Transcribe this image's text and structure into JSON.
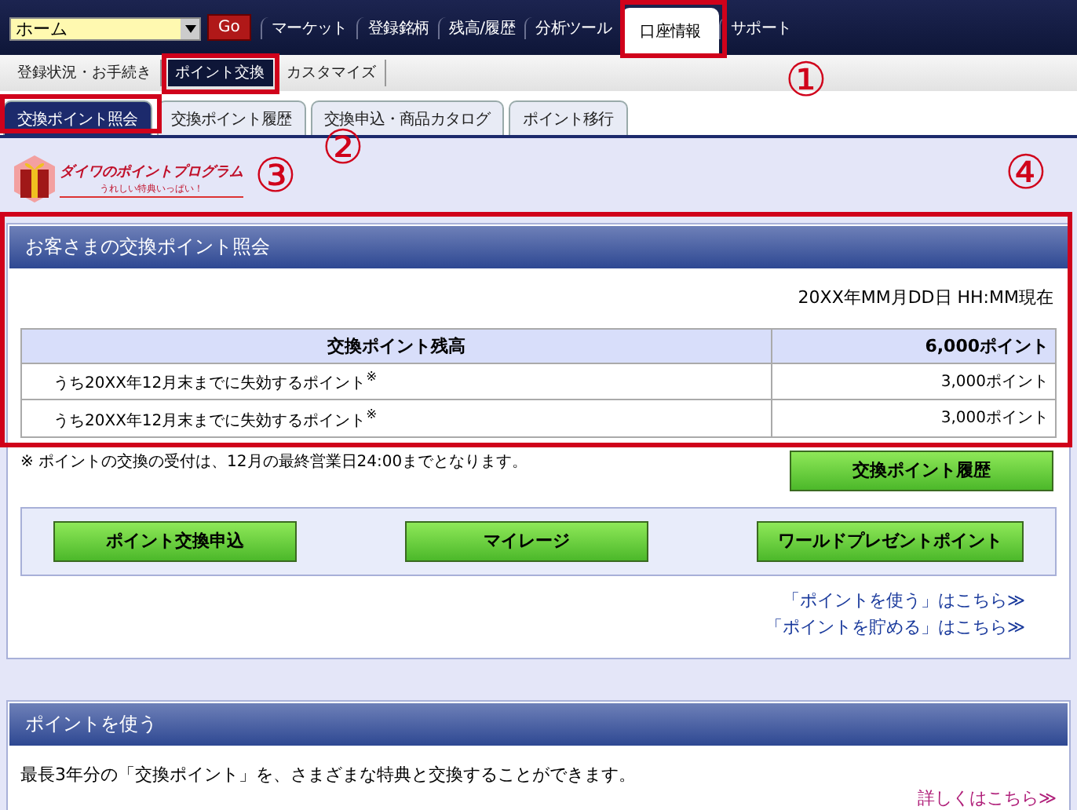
{
  "top_nav": {
    "select": "ホーム",
    "go": "Go",
    "items": [
      {
        "label": "マーケット",
        "selected": false
      },
      {
        "label": "登録銘柄",
        "selected": false
      },
      {
        "label": "残高/履歴",
        "selected": false
      },
      {
        "label": "分析ツール",
        "selected": false
      },
      {
        "label": "口座情報",
        "selected": true
      },
      {
        "label": "サポート",
        "selected": false
      }
    ]
  },
  "sub_nav": [
    {
      "label": "登録状況・お手続き",
      "selected": false
    },
    {
      "label": "ポイント交換",
      "selected": true
    },
    {
      "label": "カスタマイズ",
      "selected": false
    }
  ],
  "tabs": [
    {
      "label": "交換ポイント照会",
      "selected": true
    },
    {
      "label": "交換ポイント履歴",
      "selected": false
    },
    {
      "label": "交換申込・商品カタログ",
      "selected": false
    },
    {
      "label": "ポイント移行",
      "selected": false
    }
  ],
  "logo": {
    "title": "ダイワのポイントプログラム",
    "tagline": "うれしい特典いっぱい！"
  },
  "balance_panel": {
    "title": "お客さまの交換ポイント照会",
    "timestamp": "20XX年MM月DD日 HH:MM現在",
    "table": {
      "header": [
        "交換ポイント残高",
        "6,000ポイント"
      ],
      "rows": [
        [
          "うち20XX年12月末までに失効するポイント$^{※}$",
          "3,000ポイント"
        ],
        [
          "うち20XX年12月末までに失効するポイント$^{※}$",
          "3,000ポイント"
        ]
      ]
    },
    "note": "※ ポイントの交換の受付は、12月の最終営業日24:00までとなります。",
    "history_button": "交換ポイント履歴",
    "buttons": [
      "ポイント交換申込",
      "マイレージ",
      "ワールドプレゼントポイント"
    ],
    "links": [
      "「ポイントを使う」はこちら≫",
      "「ポイントを貯める」はこちら≫"
    ]
  },
  "use_panel": {
    "title": "ポイントを使う",
    "text": "最長3年分の「交換ポイント」を、さまざまな特典と交換することができます。",
    "link": "詳しくはこちら≫"
  },
  "annotations": [
    "①",
    "②",
    "③",
    "④"
  ]
}
